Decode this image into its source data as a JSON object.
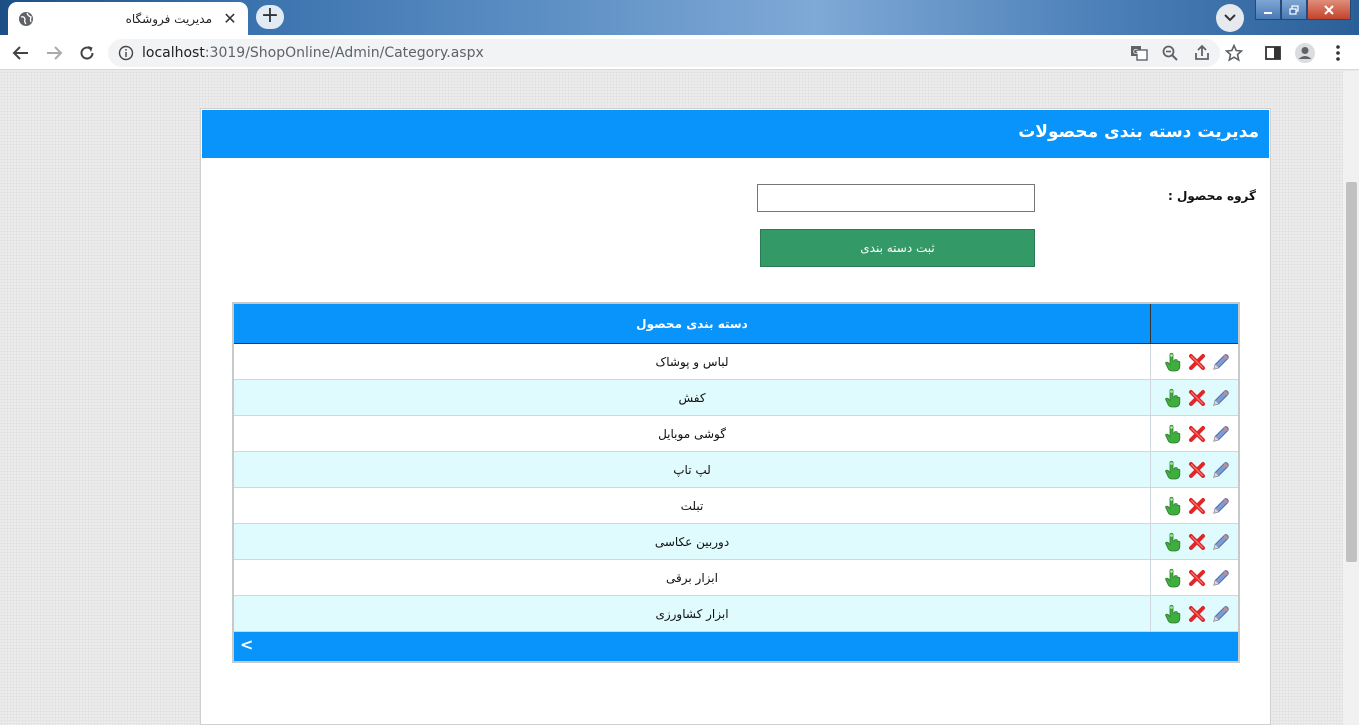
{
  "browser": {
    "tab_title": "مدیریت فروشگاه",
    "tab_close": "✕",
    "new_tab": "+",
    "url_host": "localhost",
    "url_rest": ":3019/ShopOnline/Admin/Category.aspx"
  },
  "page": {
    "header_title": "مدیریت دسته بندی محصولات",
    "field_label": "گروه محصول :",
    "field_value": "",
    "submit_label": "ثبت دسته بندی"
  },
  "grid": {
    "column_header": "دسته بندی محصول",
    "rows": [
      {
        "name": "لباس و پوشاک"
      },
      {
        "name": "کفش"
      },
      {
        "name": "گوشی موبایل"
      },
      {
        "name": "لپ تاپ"
      },
      {
        "name": "تبلت"
      },
      {
        "name": "دوربین عکاسی"
      },
      {
        "name": "ابزار برقی"
      },
      {
        "name": "ابزار کشاورزی"
      }
    ],
    "pager_label": "<"
  },
  "colors": {
    "header_blue": "#0894fb",
    "button_green": "#339966",
    "alt_row": "#e0fbfd"
  },
  "icons": [
    "select-hand-icon",
    "delete-x-icon",
    "edit-pencil-icon"
  ]
}
